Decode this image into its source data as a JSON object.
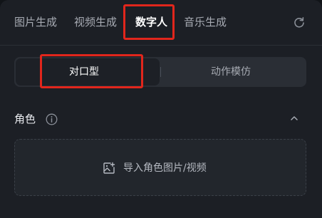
{
  "tabs": [
    {
      "label": "图片生成",
      "active": false
    },
    {
      "label": "视频生成",
      "active": false
    },
    {
      "label": "数字人",
      "active": true
    },
    {
      "label": "音乐生成",
      "active": false
    }
  ],
  "toolbar": {
    "refresh_icon": "refresh-icon"
  },
  "mode_switch": {
    "options": [
      {
        "label": "对口型",
        "active": true
      },
      {
        "label": "动作模仿",
        "active": false
      }
    ]
  },
  "role_section": {
    "title": "角色",
    "info_icon": "info-icon",
    "collapse_icon": "chevron-up-icon",
    "upload_label": "导入角色图片/视频",
    "upload_icon": "image-add-icon"
  },
  "colors": {
    "highlight": "#e1261c",
    "panel": "#1c1f25",
    "text_active": "#ffffff",
    "text_muted": "#a7abb3"
  }
}
